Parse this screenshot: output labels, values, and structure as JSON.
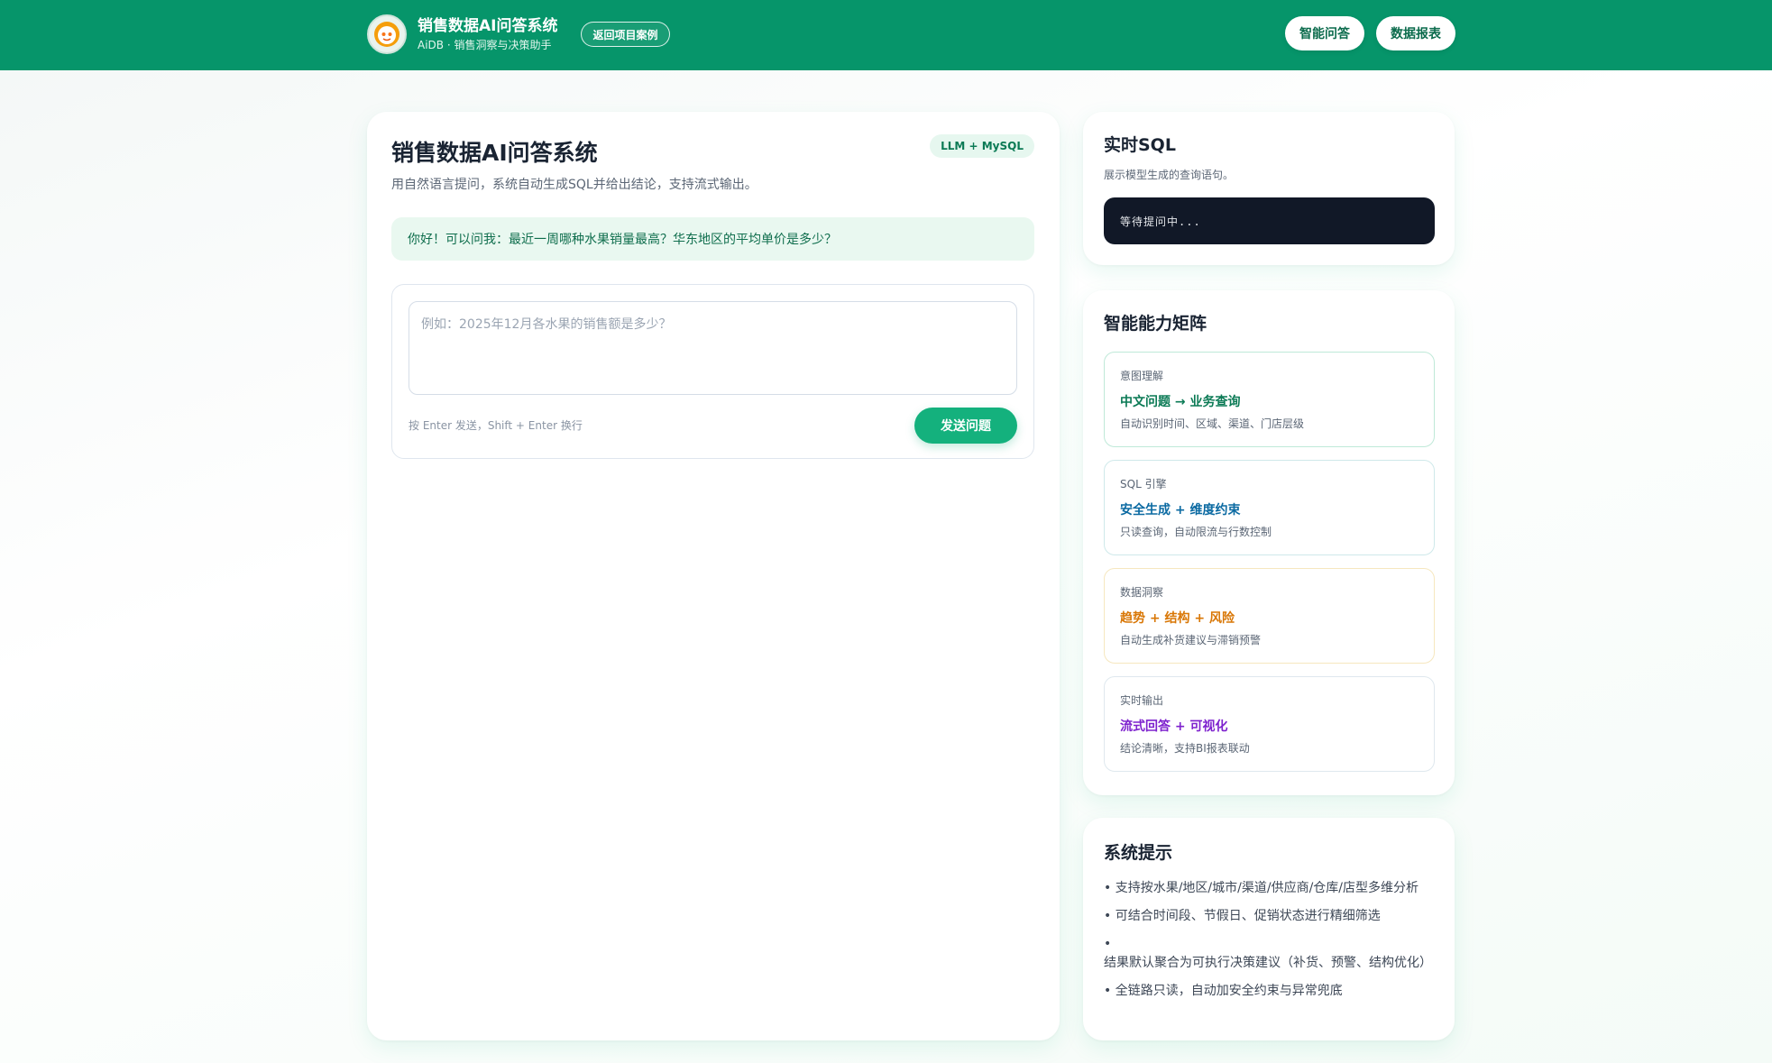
{
  "header": {
    "app_title": "销售数据AI问答系统",
    "app_subtitle": "AiDB · 销售洞察与决策助手",
    "back_label": "返回项目案例",
    "nav": [
      {
        "label": "智能问答"
      },
      {
        "label": "数据报表"
      }
    ],
    "logo_icon": "robot-avatar-icon"
  },
  "main": {
    "title": "销售数据AI问答系统",
    "badge": "LLM + MySQL",
    "description": "用自然语言提问，系统自动生成SQL并给出结论，支持流式输出。",
    "greeting": "你好！可以问我：最近一周哪种水果销量最高？华东地区的平均单价是多少？",
    "input": {
      "placeholder": "例如：2025年12月各水果的销售额是多少？",
      "value": ""
    },
    "hint": "按 Enter 发送，Shift + Enter 换行",
    "send_label": "发送问题"
  },
  "sql_panel": {
    "title": "实时SQL",
    "subtitle": "展示模型生成的查询语句。",
    "status": "等待提问中..."
  },
  "capabilities": {
    "title": "智能能力矩阵",
    "items": [
      {
        "label": "意图理解",
        "headline": "中文问题 → 业务查询",
        "desc": "自动识别时间、区域、渠道、门店层级",
        "color": "#0b7a55",
        "border": "#bfe9d8"
      },
      {
        "label": "SQL 引擎",
        "headline": "安全生成 + 维度约束",
        "desc": "只读查询，自动限流与行数控制",
        "color": "#0b6aa2",
        "border": "#cfe9ea"
      },
      {
        "label": "数据洞察",
        "headline": "趋势 + 结构 + 风险",
        "desc": "自动生成补货建议与滞销预警",
        "color": "#d97706",
        "border": "#f6e7bf"
      },
      {
        "label": "实时输出",
        "headline": "流式回答 + 可视化",
        "desc": "结论清晰，支持BI报表联动",
        "color": "#7e22ce",
        "border": "#dfe8ee"
      }
    ]
  },
  "tips": {
    "title": "系统提示",
    "items": [
      "支持按水果/地区/城市/渠道/供应商/仓库/店型多维分析",
      "可结合时间段、节假日、促销状态进行精细筛选",
      "结果默认聚合为可执行决策建议（补货、预警、结构优化）",
      "全链路只读，自动加安全约束与异常兜底"
    ]
  },
  "colors": {
    "brand": "#06956a",
    "accent": "#14b17d"
  }
}
